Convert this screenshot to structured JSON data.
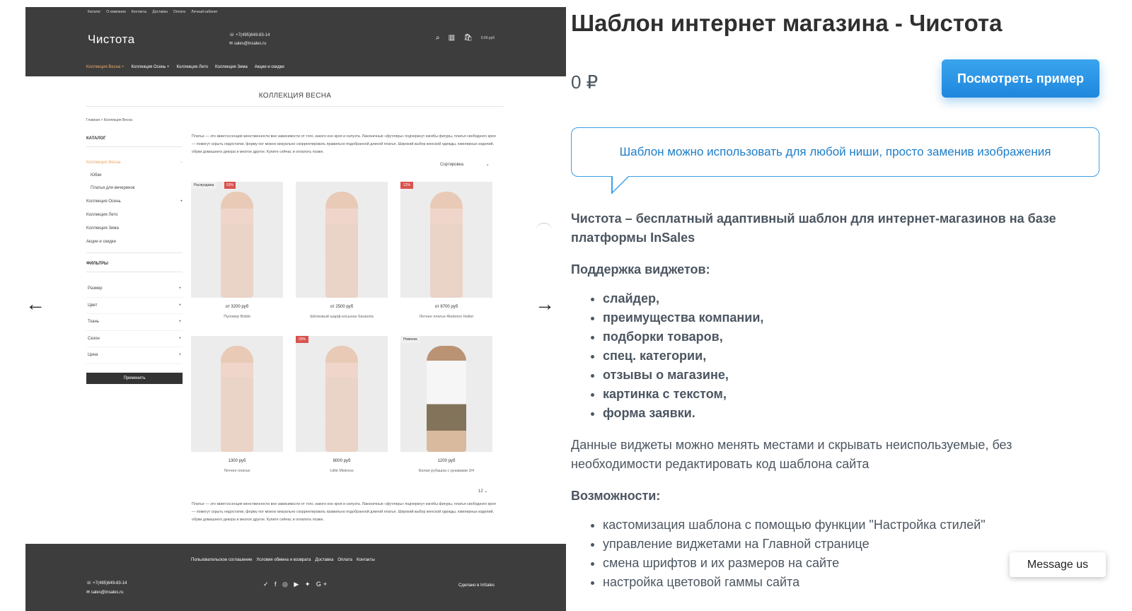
{
  "preview": {
    "topnav": [
      "Каталог",
      "О компании",
      "Контакты",
      "Доставка",
      "Оплата",
      "Личный кабинет"
    ],
    "logo": "Чистота",
    "phone": "+7(495)649-83-14",
    "email": "sales@insales.ru",
    "cart_count": "0",
    "cart_total": "0.00 руб",
    "categories": [
      "Коллекция Весна +",
      "Коллекция Осень +",
      "Коллекция Лето",
      "Коллекция Зима",
      "Акции и скидки"
    ],
    "page_title": "КОЛЛЕКЦИЯ ВЕСНА",
    "breadcrumb": "Главная  >  Коллекция Весна",
    "catalog_heading": "КАТАЛОГ",
    "catalog_items": [
      {
        "label": "Коллекция Весна",
        "mark": "−",
        "active": true,
        "sub": false
      },
      {
        "label": "Юбки",
        "mark": "",
        "active": false,
        "sub": true
      },
      {
        "label": "Платья для вечеринок",
        "mark": "",
        "active": false,
        "sub": true
      },
      {
        "label": "Коллекция Осень",
        "mark": "+",
        "active": false,
        "sub": false
      },
      {
        "label": "Коллекция Лето",
        "mark": "",
        "active": false,
        "sub": false
      },
      {
        "label": "Коллекция Зима",
        "mark": "",
        "active": false,
        "sub": false
      },
      {
        "label": "Акции и скидки",
        "mark": "",
        "active": false,
        "sub": false
      }
    ],
    "filters_heading": "ФИЛЬТРЫ",
    "filters": [
      "Размер",
      "Цвет",
      "Ткань",
      "Сезон",
      "Цена"
    ],
    "filter_mark": "+",
    "apply_label": "Применить",
    "description": "Платье — это квинтэссенция женственности вне зависимости от того, какого оно кроя и силуэта. Лаконичные «футляры» подчеркнут изгибы фигуры, платья свободного кроя — помогут скрыть недостатки, форму ног можно визуально скорректировать правильно подобранной длиной платья. Широкий выбор женской одежды, ювелирных изделий, обуви домашнего декора и многое другое. Купите сейчас и оплатить позже.",
    "sort_label": "Сортировка",
    "products": [
      {
        "badge": "Распродажа",
        "badge2": "53%",
        "price": "от 3200 руб",
        "name": "Пуловер Bobbi"
      },
      {
        "badge": "",
        "badge2": "",
        "price": "от 2500 руб",
        "name": "Шёлковый шарф-косынка Sarasota"
      },
      {
        "badge": "12%",
        "badge2": "",
        "price": "от 8700 руб",
        "name": "Летнее платье Akebono Halter"
      },
      {
        "badge": "",
        "badge2": "",
        "price": "1300 руб",
        "name": "Летнее платье"
      },
      {
        "badge": "33%",
        "badge2": "",
        "price": "8000 руб",
        "name": "Little Mistress"
      },
      {
        "badge": "Новинка",
        "badge2": "",
        "price": "1200 руб",
        "name": "Белая рубашка с рукавами 3/4"
      }
    ],
    "pager": "12",
    "footer_links": [
      "Пользовательское соглашение",
      "Условия обмена и возврата",
      "Доставка",
      "Оплата",
      "Контакты"
    ],
    "footer_phone": "+7(495)649-83-14",
    "footer_email": "sales@insales.ru",
    "footer_social": "✓ f ◎ ▶ ✦ G+",
    "footer_made": "Сделано в InSales"
  },
  "slider": {
    "prev": "←",
    "next": "→"
  },
  "product": {
    "title": "Шаблон интернет магазина - Чистота",
    "price": "0 ₽",
    "view_button": "Посмотреть пример",
    "bubble_text": "Шаблон можно использовать для любой ниши, просто заменив изображения",
    "intro": "Чистота – бесплатный адаптивный шаблон для интернет-магазинов на базе платформы InSales",
    "widgets_heading": "Поддержка виджетов:",
    "widgets": [
      "слайдер,",
      "преимущества компании,",
      "подборки товаров,",
      "спец. категории,",
      "отзывы о магазине,",
      "картинка с текстом,",
      "форма заявки."
    ],
    "widgets_note": "Данные виджеты можно менять местами и скрывать неиспользуемые, без необходимости редактировать код шаблона сайта",
    "features_heading": "Возможности:",
    "features": [
      "кастомизация шаблона с помощью функции \"Настройка стилей\"",
      "управление виджетами на Главной странице",
      "смена шрифтов и их размеров на сайте",
      "настройка цветовой гаммы сайта"
    ]
  },
  "chat": {
    "label": "Message us"
  },
  "colors": {
    "accent": "#1e87dd",
    "text": "#4c5661",
    "preview_dark": "#3d3d3d",
    "preview_accent": "#e9a76b"
  }
}
